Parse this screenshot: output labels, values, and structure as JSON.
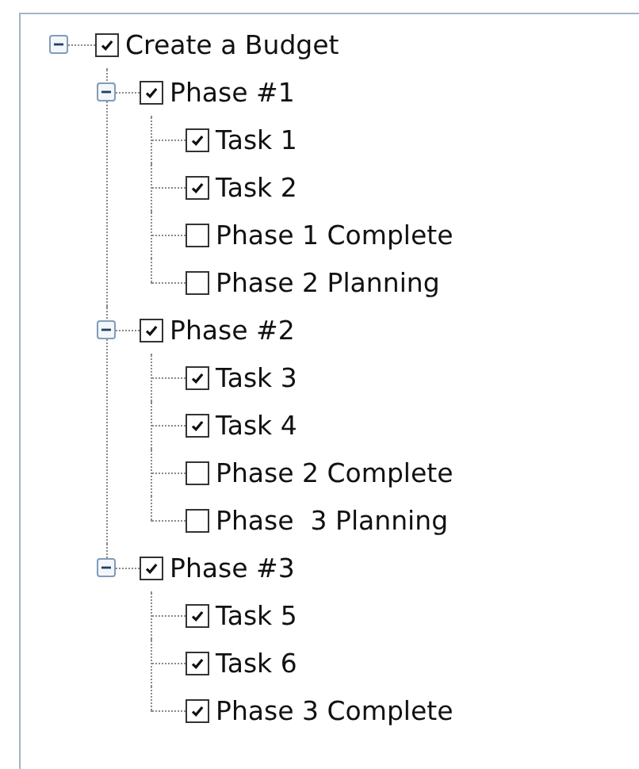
{
  "tree": [
    {
      "label": "Create a Budget",
      "checked": true,
      "expanded": true,
      "children": [
        {
          "label": "Phase #1",
          "checked": true,
          "expanded": true,
          "children": [
            {
              "label": "Task 1",
              "checked": true
            },
            {
              "label": "Task 2",
              "checked": true
            },
            {
              "label": "Phase 1 Complete",
              "checked": false
            },
            {
              "label": "Phase 2 Planning",
              "checked": false
            }
          ]
        },
        {
          "label": "Phase #2",
          "checked": true,
          "expanded": true,
          "children": [
            {
              "label": "Task 3",
              "checked": true
            },
            {
              "label": "Task 4",
              "checked": true
            },
            {
              "label": "Phase 2 Complete",
              "checked": false
            },
            {
              "label": "Phase  3 Planning",
              "checked": false
            }
          ]
        },
        {
          "label": "Phase #3",
          "checked": true,
          "expanded": true,
          "children": [
            {
              "label": "Task 5",
              "checked": true
            },
            {
              "label": "Task 6",
              "checked": true
            },
            {
              "label": "Phase 3 Complete",
              "checked": true
            }
          ]
        }
      ]
    }
  ]
}
